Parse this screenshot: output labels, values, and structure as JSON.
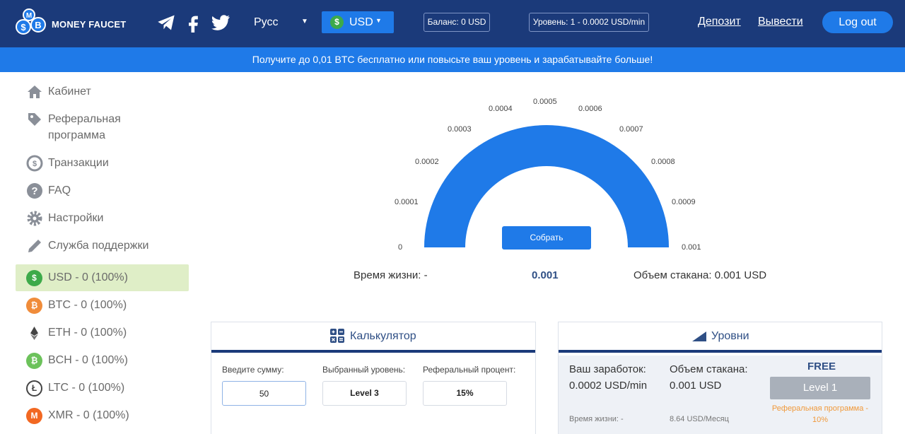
{
  "header": {
    "brand": "MONEY FAUCET",
    "language": "Русс",
    "currency": "USD",
    "balance": "Баланс: 0 USD",
    "level": "Уровень: 1 - 0.0002 USD/min",
    "deposit": "Депозит",
    "withdraw": "Вывести",
    "logout": "Log out"
  },
  "banner": "Получите до 0,01 BTC бесплатно или повысьте ваш уровень и зарабатывайте больше!",
  "sidebar": {
    "items": [
      {
        "label": "Кабинет"
      },
      {
        "label": "Реферальная"
      },
      {
        "label": "программа"
      },
      {
        "label": "Транзакции"
      },
      {
        "label": "FAQ"
      },
      {
        "label": "Настройки"
      },
      {
        "label": "Служба поддержки"
      }
    ],
    "currencies": [
      {
        "label": "USD - 0 (100%)",
        "color": "#3daa4a",
        "glyph": "$"
      },
      {
        "label": "BTC - 0 (100%)",
        "color": "#f08c3a",
        "glyph": "₿"
      },
      {
        "label": "ETH - 0 (100%)",
        "color": "#ffffff",
        "glyph": "◆"
      },
      {
        "label": "BCH - 0 (100%)",
        "color": "#6cc25b",
        "glyph": "₿"
      },
      {
        "label": "LTC - 0 (100%)",
        "color": "#ffffff",
        "glyph": "Ł"
      },
      {
        "label": "XMR - 0 (100%)",
        "color": "#f26822",
        "glyph": "M"
      }
    ]
  },
  "gauge": {
    "ticks": [
      "0",
      "0.0001",
      "0.0002",
      "0.0003",
      "0.0004",
      "0.0005",
      "0.0006",
      "0.0007",
      "0.0008",
      "0.0009",
      "0.001"
    ],
    "fill_fraction": 1.0,
    "collect": "Собрать",
    "lifetime": "Время жизни: -",
    "value": "0.001",
    "volume": "Объем стакана: 0.001 USD"
  },
  "calculator": {
    "title": "Калькулятор",
    "amount_label": "Введите сумму:",
    "amount_value": "50",
    "level_label": "Выбранный уровень:",
    "level_value": "Level 3",
    "ref_label": "Реферальный процент:",
    "ref_value": "15%"
  },
  "levels": {
    "title": "Уровни",
    "earn_label": "Ваш заработок:",
    "earn_value": "0.0002 USD/min",
    "volume_label": "Объем стакана:",
    "volume_value": "0.001 USD",
    "tier": "FREE",
    "tier_button": "Level 1",
    "ref_program": "Реферальная программа - 10%",
    "lifetime": "Время жизни: -",
    "monthly": "8.64 USD/Месяц"
  },
  "colors": {
    "header_bg": "#1b3a7a",
    "accent": "#1f7ae8",
    "active_row": "#dfeec7"
  }
}
